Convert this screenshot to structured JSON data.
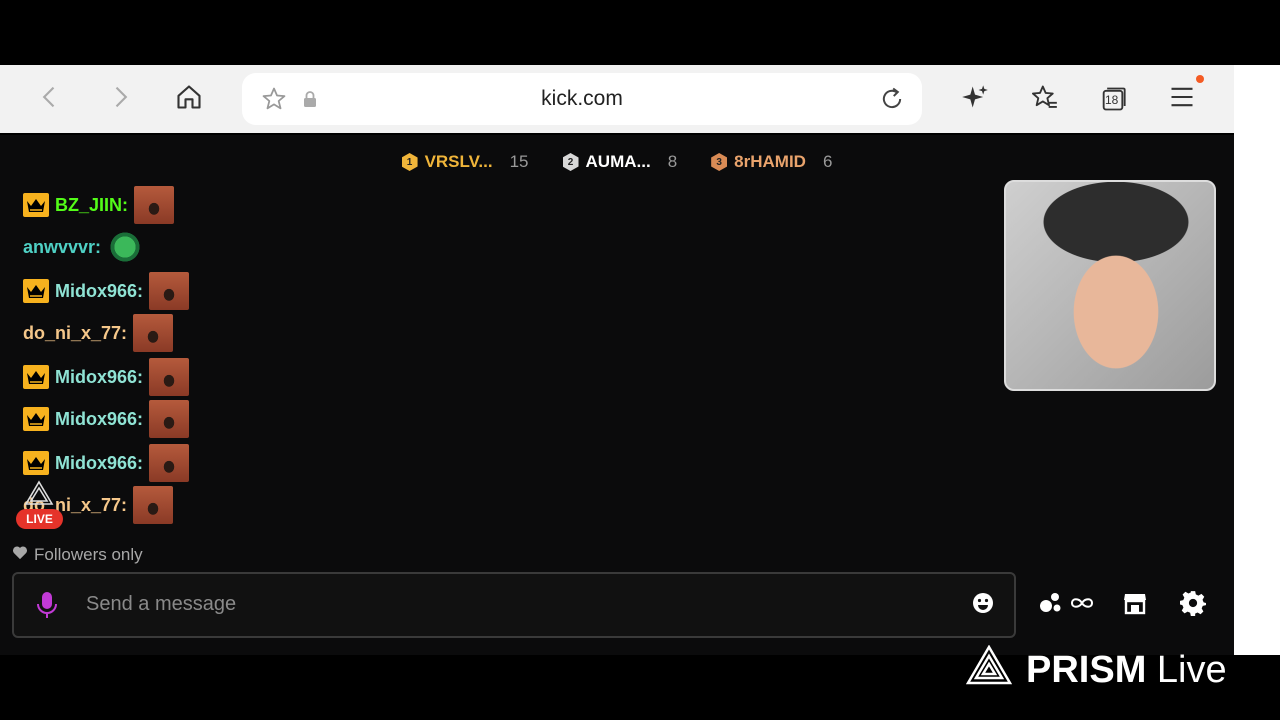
{
  "browser": {
    "url": "kick.com",
    "tab_count": "18"
  },
  "leaderboard": [
    {
      "rank": "1",
      "name": "VRSLV...",
      "count": "15",
      "color": "#f0b53a",
      "name_color": "#f0b53a"
    },
    {
      "rank": "2",
      "name": "AUMA...",
      "count": "8",
      "color": "#d8d8d8",
      "name_color": "#ffffff"
    },
    {
      "rank": "3",
      "name": "8rHAMID",
      "count": "6",
      "color": "#d98b55",
      "name_color": "#e9a36c"
    }
  ],
  "messages": [
    {
      "user": "BZ_JIIN:",
      "color": "#53fc18",
      "crown": true,
      "emote": "face"
    },
    {
      "user": "anwvvvr:",
      "color": "#4fd1c5",
      "crown": false,
      "emote": "pepe"
    },
    {
      "user": "Midox966:",
      "color": "#8fe3d4",
      "crown": true,
      "emote": "face"
    },
    {
      "user": "do_ni_x_77:",
      "color": "#f5c78a",
      "crown": false,
      "emote": "face"
    },
    {
      "user": "Midox966:",
      "color": "#8fe3d4",
      "crown": true,
      "emote": "face"
    },
    {
      "user": "Midox966:",
      "color": "#8fe3d4",
      "crown": true,
      "emote": "face"
    },
    {
      "user": "Midox966:",
      "color": "#8fe3d4",
      "crown": true,
      "emote": "face"
    },
    {
      "user": "do_ni_x_77:",
      "color": "#f5c78a",
      "crown": false,
      "emote": "face"
    }
  ],
  "live_badge": "LIVE",
  "chat_mode": "Followers only",
  "input": {
    "placeholder": "Send a message"
  },
  "watermark": {
    "brand": "PRISM",
    "word": "Live"
  }
}
